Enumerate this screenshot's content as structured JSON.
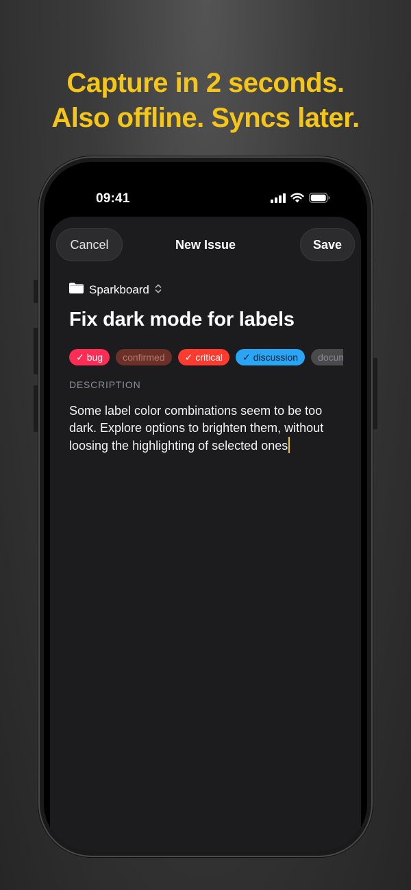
{
  "headline": {
    "line1": "Capture in 2 seconds.",
    "line2": "Also offline. Syncs later.",
    "color": "#f5c518"
  },
  "status_bar": {
    "time": "09:41",
    "icons": [
      "cellular-signal-icon",
      "wifi-icon",
      "battery-icon"
    ]
  },
  "nav": {
    "cancel_label": "Cancel",
    "title": "New Issue",
    "save_label": "Save"
  },
  "project": {
    "icon": "folder-icon",
    "name": "Sparkboard",
    "chevron_icon": "chevron-up-down-icon"
  },
  "issue": {
    "title": "Fix dark mode for labels"
  },
  "labels": [
    {
      "name": "bug",
      "selected": true,
      "bg": "#ff2d55",
      "fg": "#ffffff"
    },
    {
      "name": "confirmed",
      "selected": false,
      "bg": "#6b3128",
      "fg": "#b5776b"
    },
    {
      "name": "critical",
      "selected": true,
      "bg": "#ff3b30",
      "fg": "#ffffff"
    },
    {
      "name": "discussion",
      "selected": true,
      "bg": "#2aa4f4",
      "fg": "#0c2233"
    },
    {
      "name": "documentation",
      "selected": false,
      "bg": "#4a4a4c",
      "fg": "#8a8a8e"
    }
  ],
  "description": {
    "section_label": "DESCRIPTION",
    "text": "Some label color combinations seem to be too dark. Explore options to brighten them, without loosing the highlighting of selected ones"
  },
  "colors": {
    "accent": "#f5c518",
    "sheet_bg": "#1c1c1e"
  }
}
